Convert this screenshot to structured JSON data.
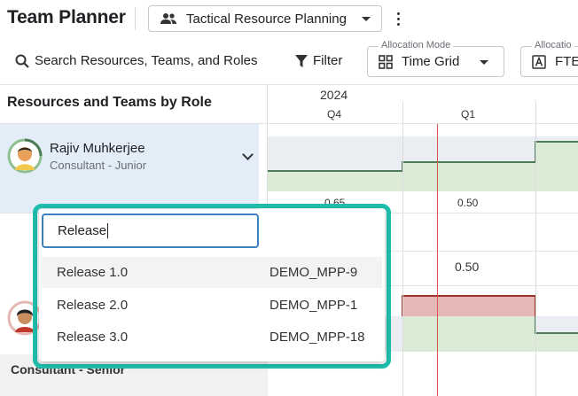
{
  "header": {
    "title": "Team Planner",
    "plan_select": {
      "value": "Tactical Resource Planning",
      "icon": "people-icon"
    }
  },
  "toolbar": {
    "search_label": "Search Resources, Teams, and Roles",
    "filter_label": "Filter",
    "allocation_mode": {
      "label": "Allocation Mode",
      "value": "Time Grid"
    },
    "allocation_unit": {
      "label": "Allocatio",
      "value": "FTE"
    }
  },
  "grid": {
    "left_header": "Resources and Teams by Role",
    "year": "2024",
    "quarters": [
      "Q4",
      "Q1"
    ]
  },
  "resource": {
    "name": "Rajiv Muhkerjee",
    "role": "Consultant - Junior",
    "values": {
      "q4_partial": "0.65",
      "q1": "0.50",
      "q1_total": "0.50"
    }
  },
  "role_group": {
    "label": "Consultant - Senior"
  },
  "dropdown": {
    "query": "Release",
    "options": [
      {
        "name": "Release 1.0",
        "code": "DEMO_MPP-9"
      },
      {
        "name": "Release 2.0",
        "code": "DEMO_MPP-1"
      },
      {
        "name": "Release 3.0",
        "code": "DEMO_MPP-18"
      }
    ]
  },
  "colors": {
    "accent": "#1fbfae",
    "focus": "#3b82c4",
    "today": "#d9534f",
    "allocation_line": "#4d7a57",
    "over_allocation": "#9b2f2a"
  }
}
